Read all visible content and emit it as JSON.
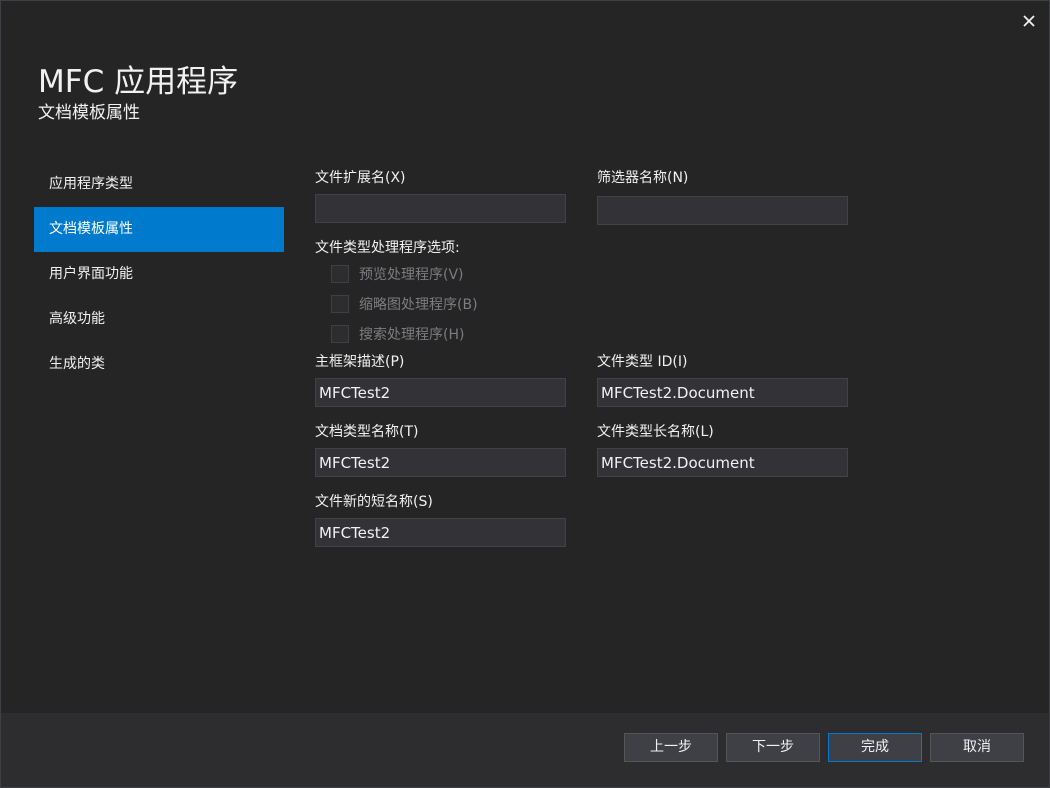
{
  "window": {
    "close_icon": "close-icon"
  },
  "header": {
    "title": "MFC 应用程序",
    "subtitle": "文档模板属性"
  },
  "sidebar": {
    "items": [
      {
        "label": "应用程序类型",
        "active": false
      },
      {
        "label": "文档模板属性",
        "active": true
      },
      {
        "label": "用户界面功能",
        "active": false
      },
      {
        "label": "高级功能",
        "active": false
      },
      {
        "label": "生成的类",
        "active": false
      }
    ]
  },
  "form": {
    "file_extension": {
      "label": "文件扩展名(X)",
      "value": ""
    },
    "filter_name": {
      "label": "筛选器名称(N)",
      "value": ""
    },
    "handler_options": {
      "label": "文件类型处理程序选项:",
      "options": [
        {
          "label": "预览处理程序(V)",
          "checked": false,
          "enabled": false
        },
        {
          "label": "缩略图处理程序(B)",
          "checked": false,
          "enabled": false
        },
        {
          "label": "搜索处理程序(H)",
          "checked": false,
          "enabled": false
        }
      ]
    },
    "main_frame_caption": {
      "label": "主框架描述(P)",
      "value": "MFCTest2"
    },
    "file_type_id": {
      "label": "文件类型 ID(I)",
      "value": "MFCTest2.Document"
    },
    "doc_type_name": {
      "label": "文档类型名称(T)",
      "value": "MFCTest2"
    },
    "file_type_long_name": {
      "label": "文件类型长名称(L)",
      "value": "MFCTest2.Document"
    },
    "file_new_short_name": {
      "label": "文件新的短名称(S)",
      "value": "MFCTest2"
    }
  },
  "footer": {
    "prev_label": "上一步",
    "next_label": "下一步",
    "finish_label": "完成",
    "cancel_label": "取消"
  },
  "colors": {
    "background": "#252526",
    "footer": "#2d2d30",
    "accent": "#007acc",
    "input_bg": "#333337",
    "disabled_text": "#7c7c80"
  }
}
